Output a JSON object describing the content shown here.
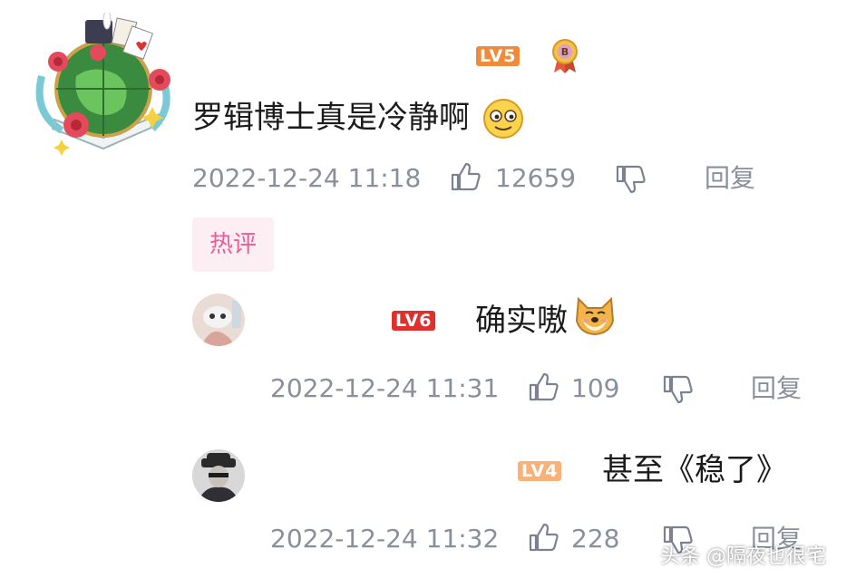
{
  "comments": [
    {
      "level": "LV5",
      "text": "罗辑博士真是冷静啊",
      "timestamp": "2022-12-24 11:18",
      "likes": "12659",
      "reply_label": "回复",
      "avatar": "globe-flowers-avatar",
      "emoji": "smiling-face-emoji"
    },
    {
      "level": "LV6",
      "text": "确实嗷",
      "timestamp": "2022-12-24 11:31",
      "likes": "109",
      "reply_label": "回复",
      "emoji": "doge-emoji"
    },
    {
      "level": "LV4",
      "text": "甚至《稳了》",
      "timestamp": "2022-12-24 11:32",
      "likes": "228",
      "reply_label": "回复"
    }
  ],
  "hot_tag": "热评",
  "watermark": "头条 @隔夜也很宅",
  "colors": {
    "lv5": "#f08a3c",
    "lv6": "#e0302c",
    "lv4": "#f7b27a",
    "hot_tag_bg": "#fdeef3",
    "hot_tag_text": "#e95e95",
    "meta_text": "#8a8f9c"
  }
}
